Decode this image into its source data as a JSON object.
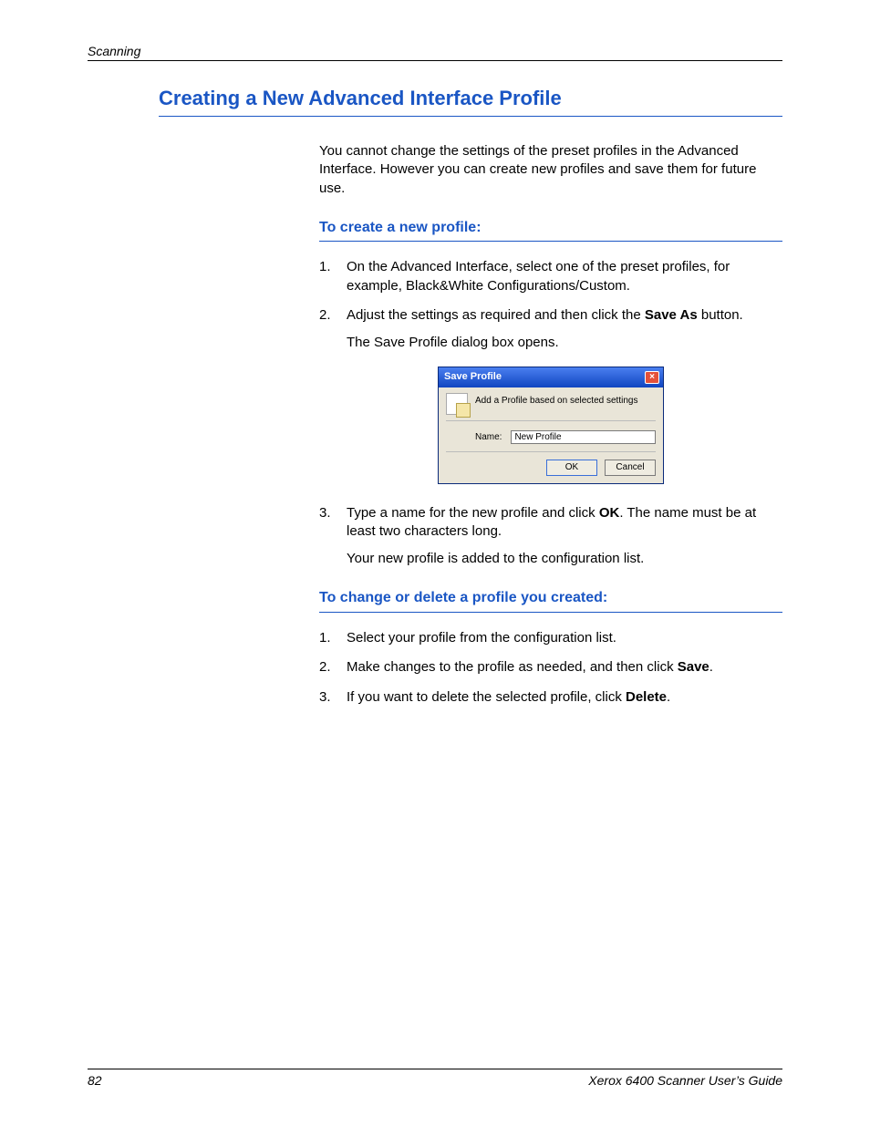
{
  "header": {
    "running_head": "Scanning"
  },
  "title": "Creating a New Advanced Interface Profile",
  "intro": "You cannot change the settings of the preset profiles in the Advanced Interface. However you can create new profiles and save them for future use.",
  "section1": {
    "heading": "To create a new profile:",
    "step1": "On the Advanced Interface, select one of the preset profiles, for example, Black&White Configurations/Custom.",
    "step2_a": "Adjust the settings as required and then click the ",
    "step2_bold": "Save As",
    "step2_b": " button.",
    "step2_after": "The Save Profile dialog box opens.",
    "step3_a": "Type a name for the new profile and click ",
    "step3_bold": "OK",
    "step3_b": ". The name must be at least two characters long.",
    "step3_after": "Your new profile is added to the configuration list."
  },
  "dialog": {
    "title": "Save Profile",
    "desc": "Add a Profile based on selected settings",
    "name_label": "Name:",
    "name_value": "New Profile",
    "ok": "OK",
    "cancel": "Cancel",
    "close_glyph": "×"
  },
  "section2": {
    "heading": "To change or delete a profile you created:",
    "step1": "Select your profile from the configuration list.",
    "step2_a": "Make changes to the profile as needed, and then click ",
    "step2_bold": "Save",
    "step2_b": ".",
    "step3_a": "If you want to delete the selected profile, click ",
    "step3_bold": "Delete",
    "step3_b": "."
  },
  "footer": {
    "page_number": "82",
    "doc_title": "Xerox 6400 Scanner User’s Guide"
  }
}
